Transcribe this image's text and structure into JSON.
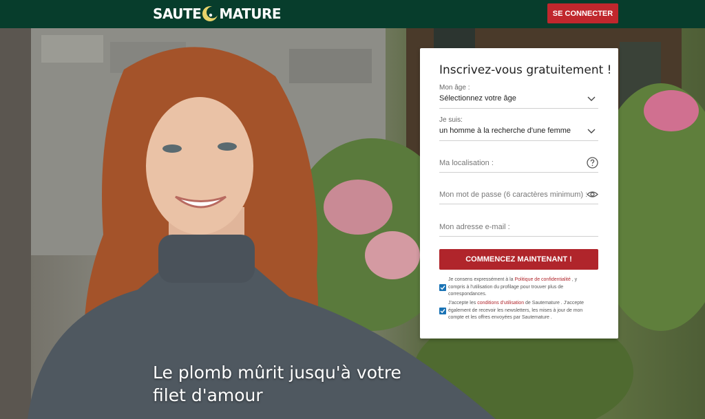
{
  "header": {
    "logo_left": "SAUTE",
    "logo_right": "MATURE",
    "login_label": "SE CONNECTER",
    "bg_color": "#073d2c",
    "accent": "#c0272d"
  },
  "hero": {
    "tagline_line1": "Le plomb mûrit jusqu'à votre",
    "tagline_line2": "filet d'amour"
  },
  "form": {
    "title": "Inscrivez-vous gratuitement !",
    "age": {
      "label": "Mon âge :",
      "value": "Sélectionnez votre âge"
    },
    "gender": {
      "label": "Je suis:",
      "value": "un homme à la recherche d'une femme"
    },
    "location": {
      "placeholder": "Ma localisation :"
    },
    "password": {
      "placeholder": "Mon mot de passe (6 caractères minimum) :"
    },
    "email": {
      "placeholder": "Mon adresse e-mail :"
    },
    "submit_label": "COMMENCEZ MAINTENANT !",
    "consent1": {
      "before": "Je consens expressément à la ",
      "link": "Politique de confidentialité",
      "after": " , y compris à l'utilisation du profilage pour trouver plus de correspondances.",
      "checked": true
    },
    "consent2": {
      "before": "J'accepte les ",
      "link": "conditions d'utilisation",
      "after": " de Sautemature . J'accepte également de recevoir les newsletters, les mises à jour de mon compte et les offres envoyées par Sautemature .",
      "checked": true
    }
  }
}
